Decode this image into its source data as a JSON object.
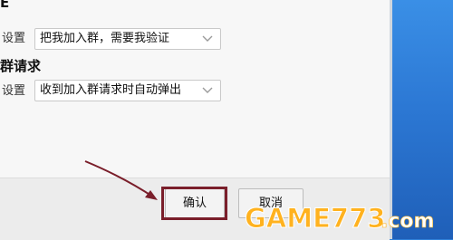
{
  "dialog": {
    "top_fragment": "E",
    "setting1": {
      "label": "设置",
      "value": "把我加入群，需要我验证"
    },
    "section2_heading": "群请求",
    "setting2": {
      "label": "设置",
      "value": "收到加入群请求时自动弹出"
    }
  },
  "buttons": {
    "confirm": "确认",
    "cancel": "取消"
  },
  "watermark": {
    "text": "GAME773.com"
  },
  "colors": {
    "highlight": "#7a1e2a",
    "desktop": "#2e7fd8",
    "watermark_a": "#ffb21f",
    "watermark_b": "#ffffff"
  }
}
